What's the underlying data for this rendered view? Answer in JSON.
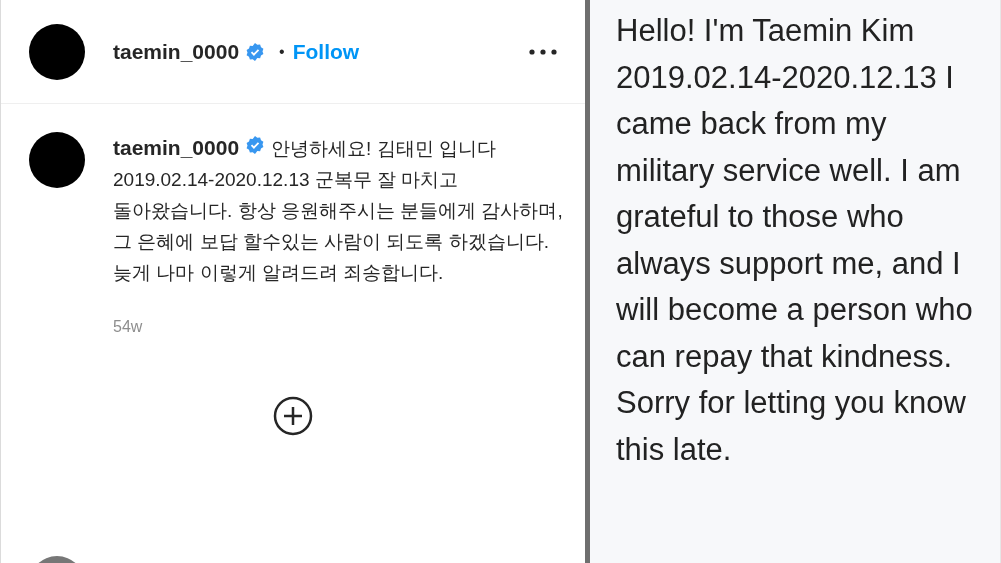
{
  "post_header": {
    "username": "taemin_0000",
    "verified": true,
    "separator": "•",
    "follow_label": "Follow"
  },
  "caption": {
    "username": "taemin_0000",
    "verified": true,
    "text": "안녕하세요! 김태민 입니다\n2019.02.14-2020.12.13 군복무 잘 마치고 돌아왔습니다. 항상 응원해주시는 분들에게 감사하며, 그 은혜에 보답 할수있는 사람이 되도록 하겠습니다. 늦게 나마 이렇게 알려드려 죄송합니다.",
    "time": "54w"
  },
  "translation": {
    "text": "Hello! I'm Taemin Kim 2019.02.14-2020.12.13 I came back from my military service well. I am grateful to those who always support me, and I will become a person who can repay that kindness. Sorry for letting you know this late."
  }
}
